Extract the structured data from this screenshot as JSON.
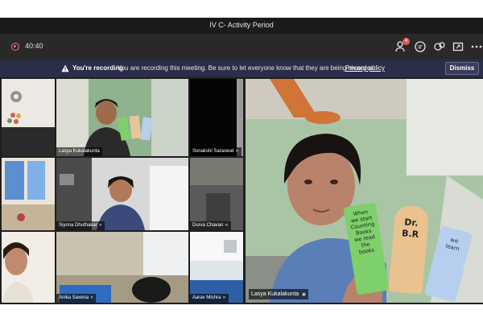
{
  "window": {
    "title": "IV C- Activity Period"
  },
  "toolbar": {
    "timer": "40:40",
    "participants_badge": "4",
    "icons": [
      "record-icon",
      "participants-icon",
      "chat-icon",
      "reactions-icon",
      "share-icon",
      "more-icon"
    ]
  },
  "banner": {
    "bold": "You're recording",
    "message": "You are recording this meeting. Be sure to let everyone know that they are being recorded.",
    "link": "Privacy policy",
    "dismiss": "Dismiss"
  },
  "participants": {
    "p1": "Lasya Kukalakunta",
    "p2": "Sonakshi Saraswat",
    "p3": "Siyona Dhuthakar",
    "p4": "Durva Chavan",
    "p5": "Anika Saxena",
    "p6": "Aarav Mishra"
  },
  "spotlight": {
    "name": "Lasya Kukalakunta",
    "bookmark1": [
      "When",
      "we start",
      "Counting",
      "Books",
      "we read",
      "the",
      "books"
    ],
    "bookmark2": [
      "Dr.",
      "B.R"
    ],
    "bookmark3": [
      "we",
      "learn"
    ]
  },
  "colors": {
    "banner": "#2b2e48",
    "toolbar": "#292929",
    "badge": "#e05a4b",
    "record": "#ff6b6b"
  }
}
